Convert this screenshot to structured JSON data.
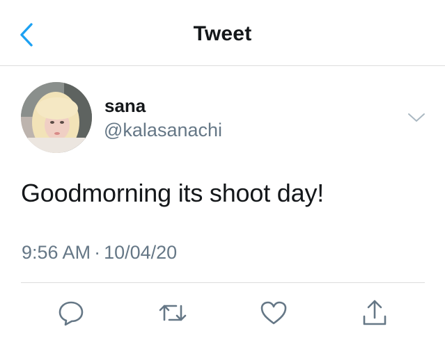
{
  "header": {
    "title": "Tweet",
    "back_icon": "chevron-left-icon",
    "accent_color": "#1da1f2"
  },
  "tweet": {
    "author": {
      "name": "sana",
      "handle": "@kalasanachi"
    },
    "text": "Goodmorning its shoot day!",
    "time": "9:56 AM",
    "date": "10/04/20",
    "separator": "·"
  },
  "actions": [
    {
      "icon": "reply-icon"
    },
    {
      "icon": "retweet-icon"
    },
    {
      "icon": "like-icon"
    },
    {
      "icon": "share-icon"
    }
  ],
  "colors": {
    "text_primary": "#14171a",
    "text_secondary": "#657786",
    "divider": "#dcdcdc",
    "icon_gray": "#657786"
  }
}
